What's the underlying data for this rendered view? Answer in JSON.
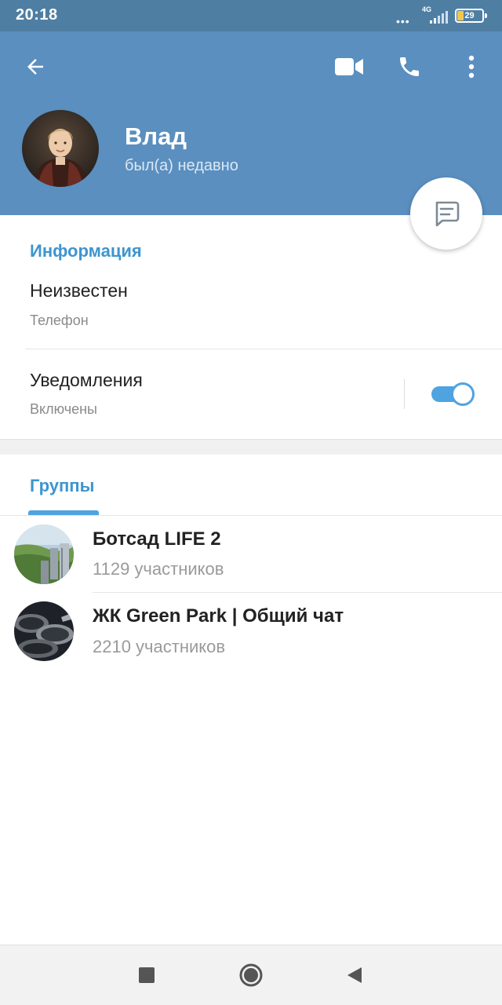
{
  "status_bar": {
    "time": "20:18",
    "network": "4G",
    "battery": "29"
  },
  "header": {
    "name": "Влад",
    "status": "был(а) недавно"
  },
  "info": {
    "section_title": "Информация",
    "phone_value": "Неизвестен",
    "phone_label": "Телефон",
    "notifications_label": "Уведомления",
    "notifications_value": "Включены",
    "notifications_on": true
  },
  "groups": {
    "tab_label": "Группы",
    "items": [
      {
        "name": "Ботсад LIFE 2",
        "members": "1129 участников"
      },
      {
        "name": "ЖК Green Park | Общий чат",
        "members": "2210 участников"
      }
    ]
  },
  "icons": {
    "back": "arrow-left-icon",
    "video": "video-camera-icon",
    "call": "phone-icon",
    "more": "more-vertical-icon",
    "message": "message-icon",
    "nav_recents": "square-icon",
    "nav_home": "circle-icon",
    "nav_back": "triangle-back-icon"
  },
  "colors": {
    "header": "#5a8fbf",
    "status_bar": "#4f7ea3",
    "accent": "#3d95ce",
    "toggle": "#4fa3e0"
  }
}
